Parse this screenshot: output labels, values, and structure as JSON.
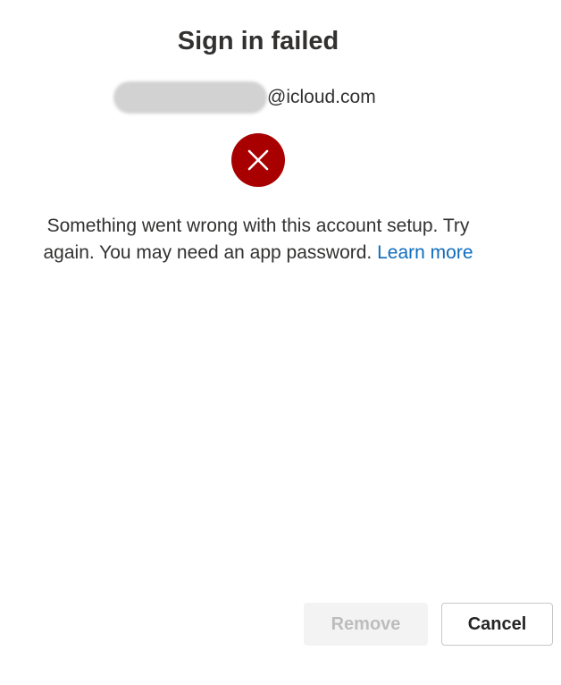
{
  "dialog": {
    "title": "Sign in failed",
    "account_domain": "@icloud.com",
    "message_text": "Something went wrong with this account setup. Try again. You may need an app password.",
    "learn_more_label": "Learn more",
    "icon": "error-x-icon",
    "error_color": "#a80000",
    "link_color": "#0f6cbd"
  },
  "buttons": {
    "remove_label": "Remove",
    "remove_state": "disabled",
    "cancel_label": "Cancel"
  }
}
